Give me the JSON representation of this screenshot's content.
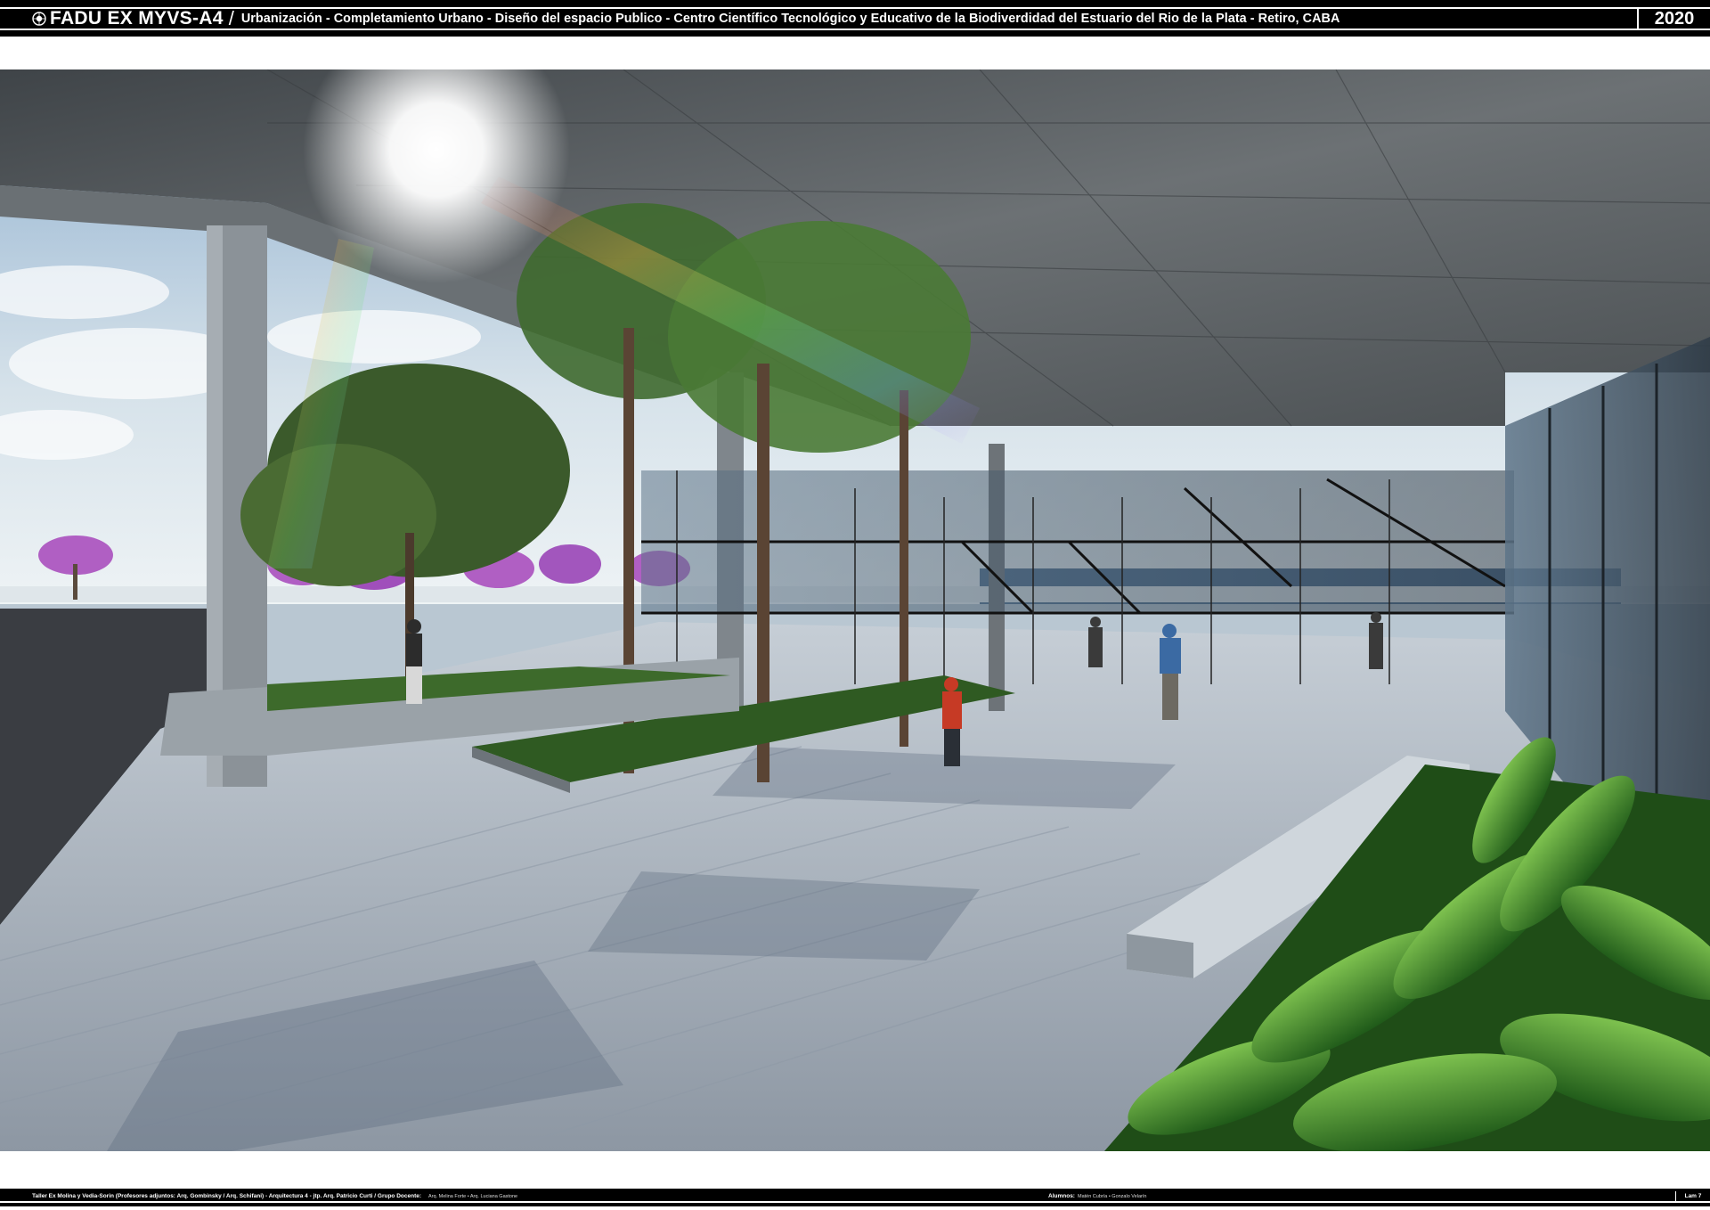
{
  "header": {
    "brand": "FADU EX MYVS-A4",
    "separator": "/",
    "subtitle": "Urbanización - Completamiento Urbano - Diseño del espacio Publico - Centro Científico Tecnológico y Educativo de la Biodiverdidad del Estuario del Rio de la Plata   - Retiro, CABA",
    "year": "2020",
    "logo_icon": "globe-seal-icon"
  },
  "render": {
    "kind": "architectural-render",
    "colors": {
      "sky": "#c9d7e2",
      "concrete_ceiling": "#5d6266",
      "pavement": "#aeb7c0",
      "planter_green": "#3e7a2a",
      "jacaranda": "#b05fc3"
    }
  },
  "footer": {
    "credits": "Taller Ex Molina y Vedia-Sorin (Profesores adjuntos:  Arq. Gombinsky / Arq. Schifani) - Arquitectura 4 - jtp. Arq. Patricio Curti / Grupo Docente:",
    "staff": "Arq. Melina Forte • Arq. Luciana Gastone",
    "students_label": "Alumnos:",
    "students": "Matén Cubría • Gonzalo Velarín",
    "sheet": "Lam 7"
  }
}
